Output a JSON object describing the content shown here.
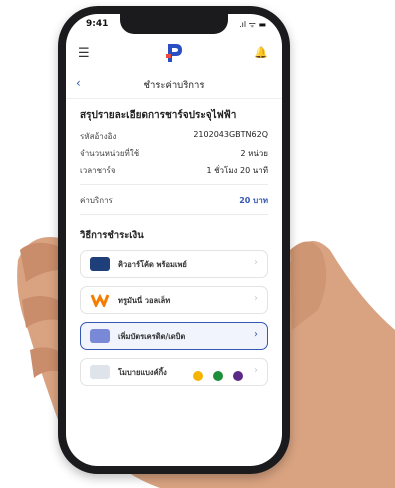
{
  "status": {
    "time": "9:41",
    "icons": ".ıl ᯤ ▬"
  },
  "nav": {
    "title": "ชำระค่าบริการ"
  },
  "summary": {
    "title": "สรุปรายละเอียดการชาร์จประจุไฟฟ้า",
    "rows": [
      {
        "label": "รหัสอ้างอิง",
        "value": "2102043GBTN62Q"
      },
      {
        "label": "จำนวนหน่วยที่ใช้",
        "value": "2 หน่วย"
      },
      {
        "label": "เวลาชาร์จ",
        "value": "1 ชั่วโมง 20 นาที"
      }
    ],
    "fee": {
      "label": "ค่าบริการ",
      "value": "20 บาท"
    }
  },
  "payment": {
    "title": "วิธีการชำระเงิน",
    "options": [
      {
        "label": "คิวอาร์โค้ด พร้อมเพย์",
        "icon": "promptpay-icon"
      },
      {
        "label": "ทรูมันนี่ วอลเล็ท",
        "icon": "truemoney-icon"
      },
      {
        "label": "เพิ่มบัตรเครดิต/เดบิต",
        "icon": "credit-card-icon"
      },
      {
        "label": "โมบายแบงค์กิ้ง",
        "icon": "mobile-banking-icon"
      }
    ]
  },
  "colors": {
    "accent": "#3457b2",
    "alert": "#e74c3c"
  }
}
